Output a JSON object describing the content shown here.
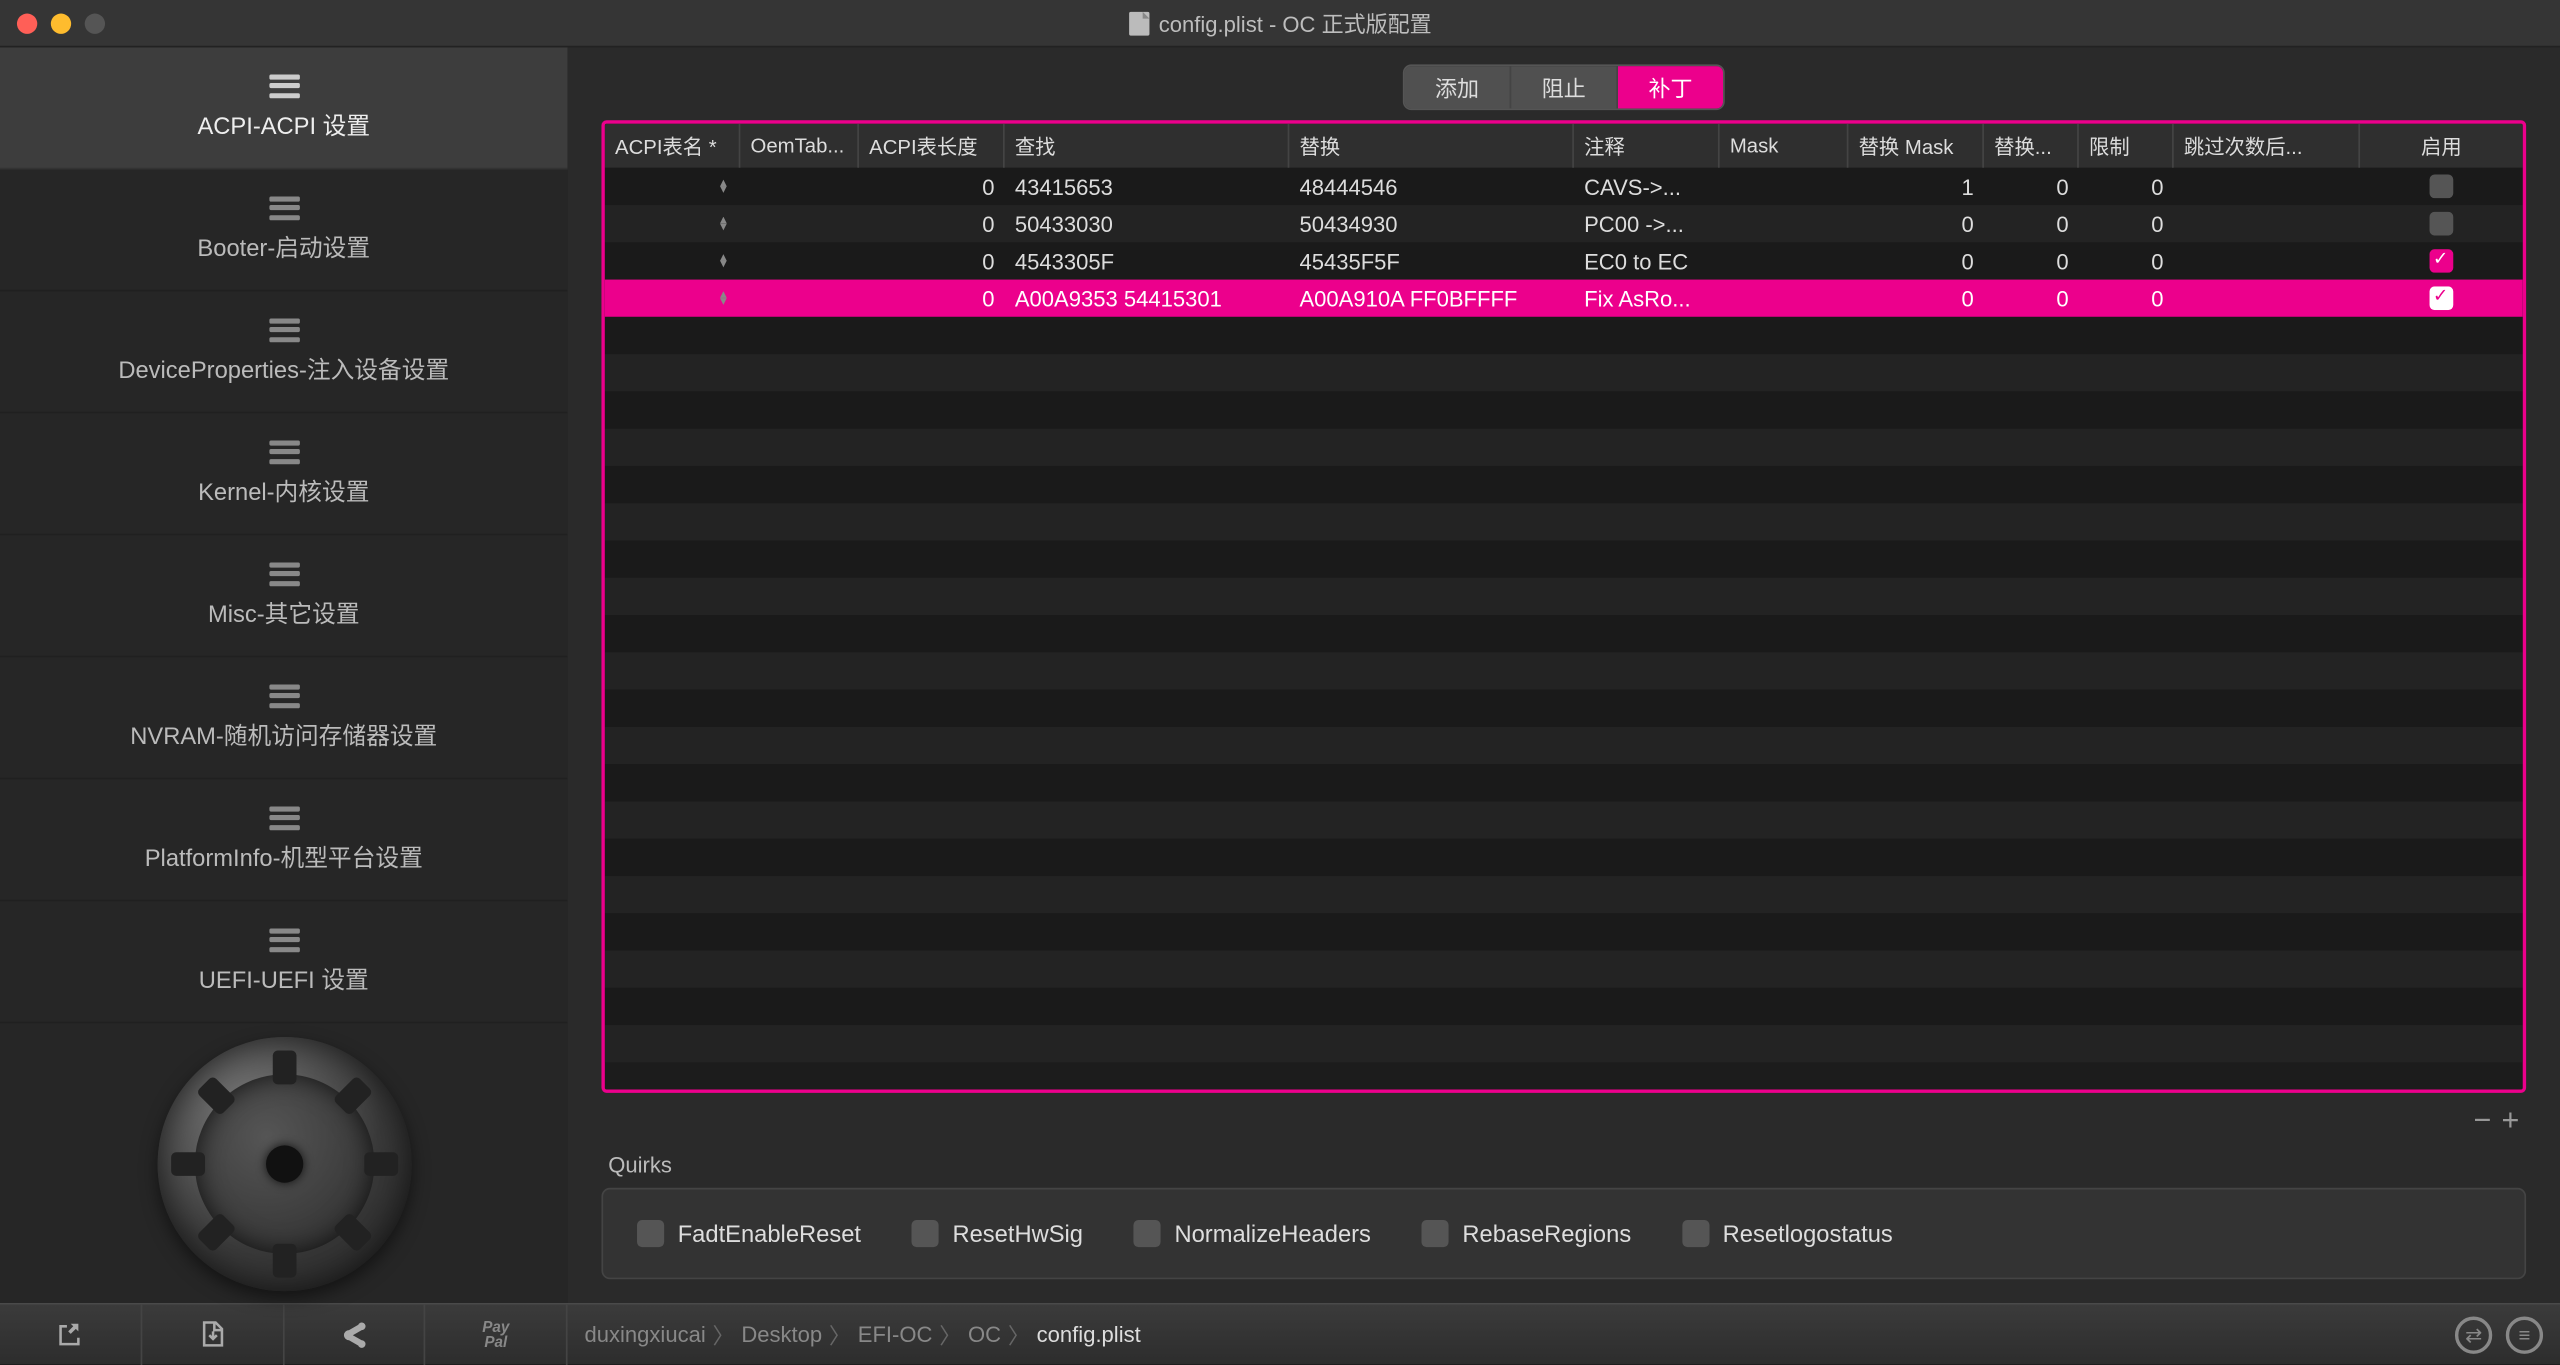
{
  "window": {
    "filename": "config.plist",
    "title_suffix": "OC 正式版配置"
  },
  "sidebar": {
    "items": [
      {
        "label": "ACPI-ACPI 设置",
        "selected": true
      },
      {
        "label": "Booter-启动设置",
        "selected": false
      },
      {
        "label": "DeviceProperties-注入设备设置",
        "selected": false
      },
      {
        "label": "Kernel-内核设置",
        "selected": false
      },
      {
        "label": "Misc-其它设置",
        "selected": false
      },
      {
        "label": "NVRAM-随机访问存储器设置",
        "selected": false
      },
      {
        "label": "PlatformInfo-机型平台设置",
        "selected": false
      },
      {
        "label": "UEFI-UEFI 设置",
        "selected": false
      }
    ]
  },
  "tabs": [
    {
      "label": "添加",
      "active": false
    },
    {
      "label": "阻止",
      "active": false
    },
    {
      "label": "补丁",
      "active": true
    }
  ],
  "table": {
    "columns": [
      "ACPI表名 *",
      "OemTab...",
      "ACPI表长度",
      "查找",
      "替换",
      "注释",
      "Mask",
      "替换 Mask",
      "替换...",
      "限制",
      "跳过次数后...",
      "启用"
    ],
    "rows": [
      {
        "tableSig": "",
        "oem": "",
        "length": "0",
        "find": "43415653",
        "replace": "48444546",
        "comment": "CAVS->...",
        "mask": "",
        "rmask": "1",
        "rcount": "0",
        "limit": "0",
        "skip": "",
        "enabled": false,
        "selected": false
      },
      {
        "tableSig": "",
        "oem": "",
        "length": "0",
        "find": "50433030",
        "replace": "50434930",
        "comment": "PC00 ->...",
        "mask": "",
        "rmask": "0",
        "rcount": "0",
        "limit": "0",
        "skip": "",
        "enabled": false,
        "selected": false
      },
      {
        "tableSig": "",
        "oem": "",
        "length": "0",
        "find": "4543305F",
        "replace": "45435F5F",
        "comment": "EC0 to EC",
        "mask": "",
        "rmask": "0",
        "rcount": "0",
        "limit": "0",
        "skip": "",
        "enabled": true,
        "selected": false
      },
      {
        "tableSig": "",
        "oem": "",
        "length": "0",
        "find": "A00A9353 54415301",
        "replace": "A00A910A FF0BFFFF",
        "comment": "Fix AsRo...",
        "mask": "",
        "rmask": "0",
        "rcount": "0",
        "limit": "0",
        "skip": "",
        "enabled": true,
        "selected": true
      }
    ]
  },
  "quirks": {
    "title": "Quirks",
    "items": [
      {
        "label": "FadtEnableReset",
        "checked": false
      },
      {
        "label": "ResetHwSig",
        "checked": false
      },
      {
        "label": "NormalizeHeaders",
        "checked": false
      },
      {
        "label": "RebaseRegions",
        "checked": false
      },
      {
        "label": "Resetlogostatus",
        "checked": false
      }
    ]
  },
  "breadcrumbs": [
    "duxingxiucai",
    "Desktop",
    "EFI-OC",
    "OC",
    "config.plist"
  ],
  "bottom_buttons": {
    "paypal": "PayPal"
  }
}
